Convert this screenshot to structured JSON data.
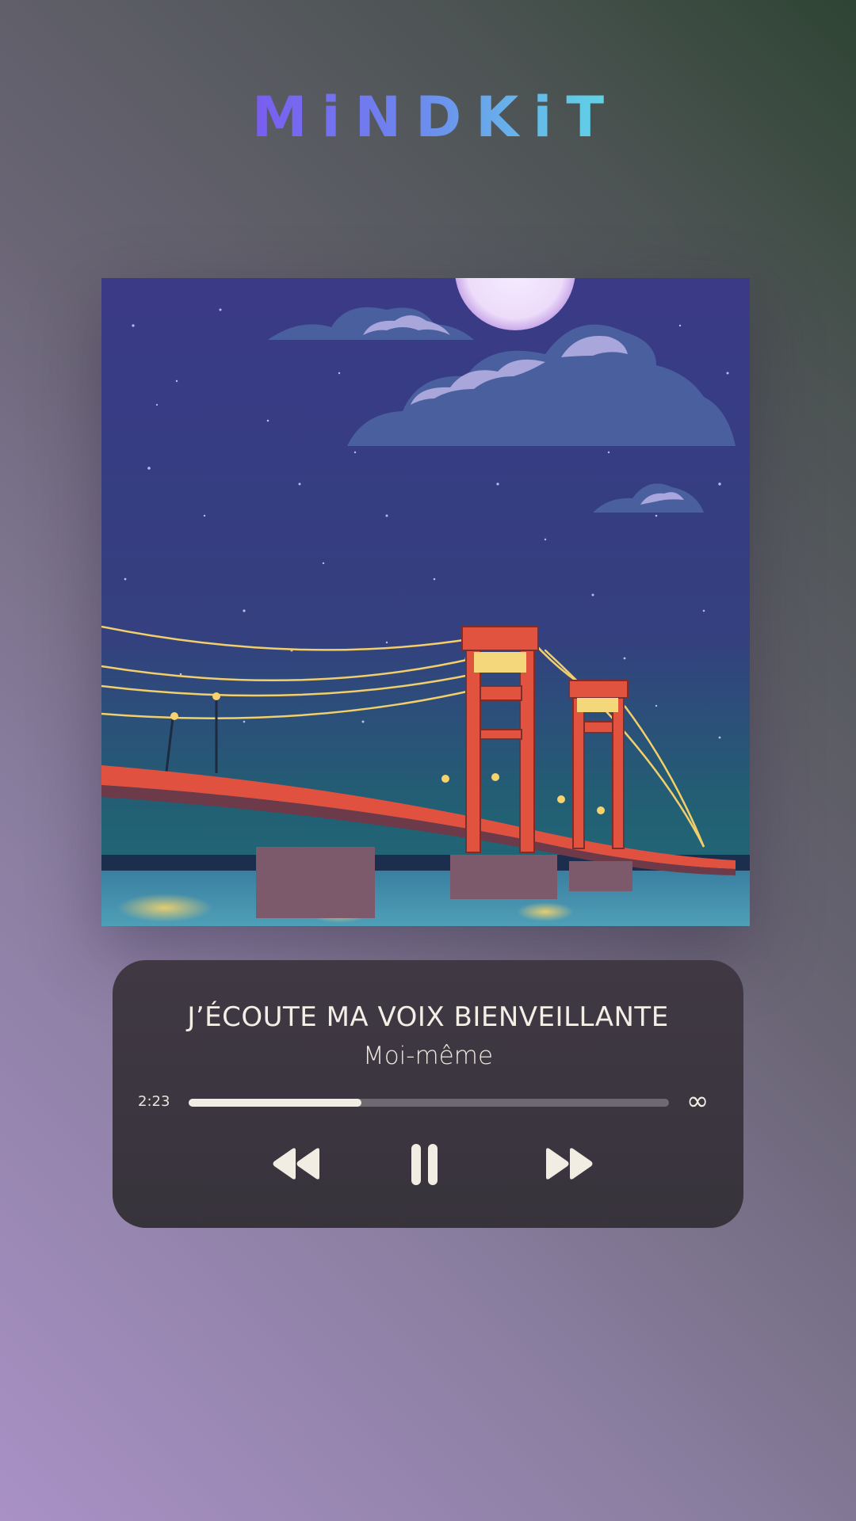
{
  "app": {
    "logo_text": "MiNDKiT",
    "logo_colors": [
      "#7b59f0",
      "#6d86ee",
      "#66b7ea",
      "#5fd6e4"
    ]
  },
  "artwork": {
    "icon": "album-artwork-image"
  },
  "player": {
    "title": "J’ÉCOUTE MA VOIX BIENVEILLANTE",
    "artist": "Moi-même",
    "elapsed": "2:23",
    "duration_icon": "infinity-icon",
    "duration_symbol": "∞",
    "progress": 0.36,
    "controls": {
      "previous_icon": "rewind-icon",
      "pause_icon": "pause-icon",
      "next_icon": "fast-forward-icon"
    }
  },
  "colors": {
    "text": "#f1ede3",
    "card": "#3b3640",
    "progress_track": "#6e6a72"
  }
}
